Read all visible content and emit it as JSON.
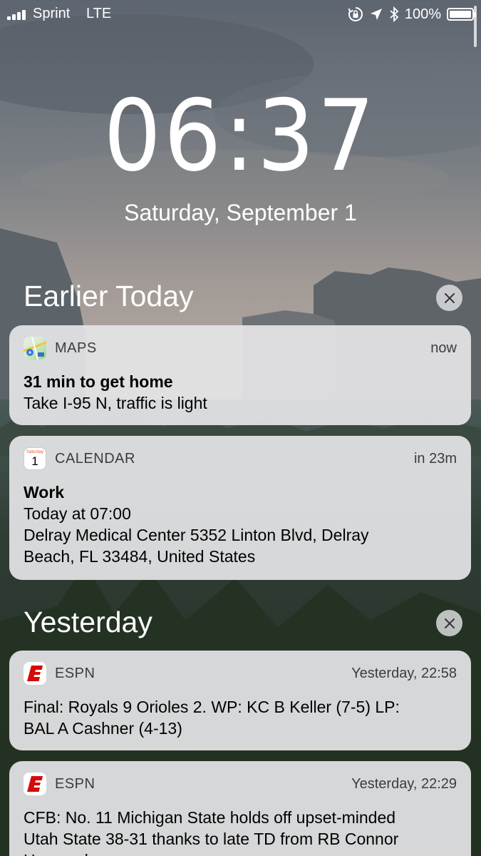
{
  "status_bar": {
    "carrier": "Sprint",
    "network": "LTE",
    "battery_percent": "100%",
    "battery_level": 1.0,
    "icons": [
      "rotation-lock-icon",
      "location-arrow-icon",
      "bluetooth-icon",
      "battery-icon"
    ]
  },
  "lock_screen": {
    "time": "06:37",
    "date": "Saturday, September 1"
  },
  "sections": [
    {
      "title": "Earlier Today",
      "clear_icon": "close-icon",
      "notifications": [
        {
          "app": "MAPS",
          "icon": "maps-app-icon",
          "time": "now",
          "title": "31 min to get home",
          "body": [
            "Take I-95 N, traffic is light"
          ]
        },
        {
          "app": "CALENDAR",
          "icon": "calendar-app-icon",
          "icon_day_label": "Saturday",
          "icon_date": "1",
          "time": "in 23m",
          "title": "Work",
          "body": [
            "Today at 07:00",
            "Delray Medical Center 5352 Linton Blvd, Delray",
            "Beach, FL  33484, United States"
          ]
        }
      ]
    },
    {
      "title": "Yesterday",
      "clear_icon": "close-icon",
      "notifications": [
        {
          "app": "ESPN",
          "icon": "espn-app-icon",
          "time": "Yesterday, 22:58",
          "body": [
            "Final: Royals 9 Orioles 2. WP: KC B Keller (7-5) LP:",
            "BAL A Cashner (4-13)"
          ]
        },
        {
          "app": "ESPN",
          "icon": "espn-app-icon",
          "time": "Yesterday, 22:29",
          "body": [
            "CFB: No. 11 Michigan State holds off upset-minded",
            "Utah State 38-31 thanks to late TD from RB Connor",
            "Heyward"
          ]
        }
      ]
    }
  ],
  "colors": {
    "espn_red": "#d50a0a",
    "card_background": "#e4e4e6"
  }
}
